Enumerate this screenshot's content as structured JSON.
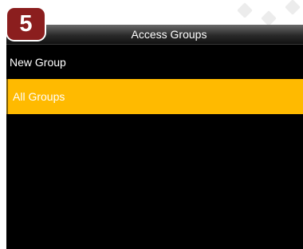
{
  "badge": {
    "number": "5"
  },
  "header": {
    "title": "Access Groups"
  },
  "menu": {
    "items": [
      {
        "label": "New Group",
        "selected": false
      },
      {
        "label": "All Groups",
        "selected": true
      }
    ]
  },
  "colors": {
    "screen_bg": "#000000",
    "selection": "#ffba00",
    "badge": "#8b1e1e"
  }
}
